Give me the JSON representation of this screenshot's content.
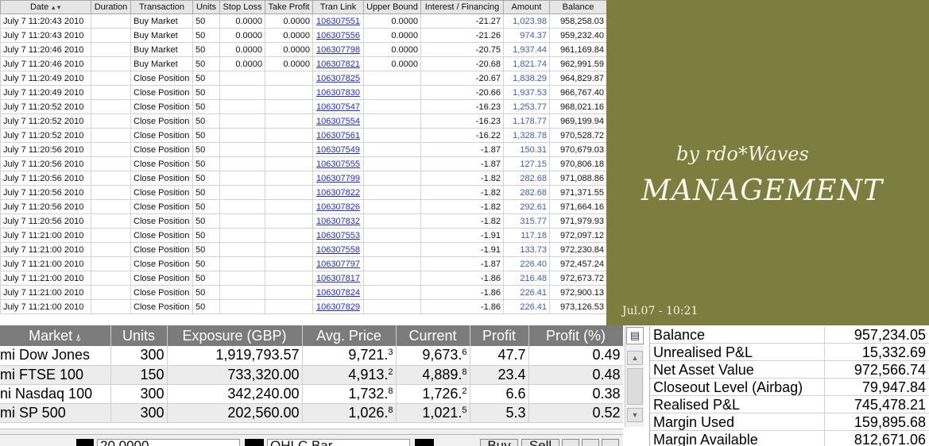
{
  "trades": {
    "columns": [
      "Date",
      "Duration",
      "Transaction",
      "Units",
      "Stop Loss",
      "Take Profit",
      "Tran Link",
      "Upper Bound",
      "Interest / Financing",
      "Amount",
      "Balance"
    ],
    "rows": [
      {
        "date": "July 7 11:20:43 2010",
        "duration": "",
        "transaction": "Buy Market",
        "units": "50",
        "stop_loss": "0.0000",
        "take_profit": "0.0000",
        "tran_link": "106307551",
        "upper_bound": "0.0000",
        "interest": "-21.27",
        "amount": "1,023.98",
        "balance": "958,258.03"
      },
      {
        "date": "July 7 11:20:43 2010",
        "duration": "",
        "transaction": "Buy Market",
        "units": "50",
        "stop_loss": "0.0000",
        "take_profit": "0.0000",
        "tran_link": "106307556",
        "upper_bound": "0.0000",
        "interest": "-21.26",
        "amount": "974.37",
        "balance": "959,232.40"
      },
      {
        "date": "July 7 11:20:46 2010",
        "duration": "",
        "transaction": "Buy Market",
        "units": "50",
        "stop_loss": "0.0000",
        "take_profit": "0.0000",
        "tran_link": "106307798",
        "upper_bound": "0.0000",
        "interest": "-20.75",
        "amount": "1,937.44",
        "balance": "961,169.84"
      },
      {
        "date": "July 7 11:20:46 2010",
        "duration": "",
        "transaction": "Buy Market",
        "units": "50",
        "stop_loss": "0.0000",
        "take_profit": "0.0000",
        "tran_link": "106307821",
        "upper_bound": "0.0000",
        "interest": "-20.68",
        "amount": "1,821.74",
        "balance": "962,991.59"
      },
      {
        "date": "July 7 11:20:49 2010",
        "duration": "",
        "transaction": "Close Position",
        "units": "50",
        "stop_loss": "",
        "take_profit": "",
        "tran_link": "106307825",
        "upper_bound": "",
        "interest": "-20.67",
        "amount": "1,838.29",
        "balance": "964,829.87"
      },
      {
        "date": "July 7 11:20:49 2010",
        "duration": "",
        "transaction": "Close Position",
        "units": "50",
        "stop_loss": "",
        "take_profit": "",
        "tran_link": "106307830",
        "upper_bound": "",
        "interest": "-20.66",
        "amount": "1,937.53",
        "balance": "966,767.40"
      },
      {
        "date": "July 7 11:20:52 2010",
        "duration": "",
        "transaction": "Close Position",
        "units": "50",
        "stop_loss": "",
        "take_profit": "",
        "tran_link": "106307547",
        "upper_bound": "",
        "interest": "-16.23",
        "amount": "1,253.77",
        "balance": "968,021.16"
      },
      {
        "date": "July 7 11:20:52 2010",
        "duration": "",
        "transaction": "Close Position",
        "units": "50",
        "stop_loss": "",
        "take_profit": "",
        "tran_link": "106307554",
        "upper_bound": "",
        "interest": "-16.23",
        "amount": "1,178.77",
        "balance": "969,199.94"
      },
      {
        "date": "July 7 11:20:52 2010",
        "duration": "",
        "transaction": "Close Position",
        "units": "50",
        "stop_loss": "",
        "take_profit": "",
        "tran_link": "106307561",
        "upper_bound": "",
        "interest": "-16.22",
        "amount": "1,328.78",
        "balance": "970,528.72"
      },
      {
        "date": "July 7 11:20:56 2010",
        "duration": "",
        "transaction": "Close Position",
        "units": "50",
        "stop_loss": "",
        "take_profit": "",
        "tran_link": "106307549",
        "upper_bound": "",
        "interest": "-1.87",
        "amount": "150.31",
        "balance": "970,679.03"
      },
      {
        "date": "July 7 11:20:56 2010",
        "duration": "",
        "transaction": "Close Position",
        "units": "50",
        "stop_loss": "",
        "take_profit": "",
        "tran_link": "106307555",
        "upper_bound": "",
        "interest": "-1.87",
        "amount": "127.15",
        "balance": "970,806.18"
      },
      {
        "date": "July 7 11:20:56 2010",
        "duration": "",
        "transaction": "Close Position",
        "units": "50",
        "stop_loss": "",
        "take_profit": "",
        "tran_link": "106307799",
        "upper_bound": "",
        "interest": "-1.82",
        "amount": "282.68",
        "balance": "971,088.86"
      },
      {
        "date": "July 7 11:20:56 2010",
        "duration": "",
        "transaction": "Close Position",
        "units": "50",
        "stop_loss": "",
        "take_profit": "",
        "tran_link": "106307822",
        "upper_bound": "",
        "interest": "-1.82",
        "amount": "282.68",
        "balance": "971,371.55"
      },
      {
        "date": "July 7 11:20:56 2010",
        "duration": "",
        "transaction": "Close Position",
        "units": "50",
        "stop_loss": "",
        "take_profit": "",
        "tran_link": "106307826",
        "upper_bound": "",
        "interest": "-1.82",
        "amount": "292.61",
        "balance": "971,664.16"
      },
      {
        "date": "July 7 11:20:56 2010",
        "duration": "",
        "transaction": "Close Position",
        "units": "50",
        "stop_loss": "",
        "take_profit": "",
        "tran_link": "106307832",
        "upper_bound": "",
        "interest": "-1.82",
        "amount": "315.77",
        "balance": "971,979.93"
      },
      {
        "date": "July 7 11:21:00 2010",
        "duration": "",
        "transaction": "Close Position",
        "units": "50",
        "stop_loss": "",
        "take_profit": "",
        "tran_link": "106307553",
        "upper_bound": "",
        "interest": "-1.91",
        "amount": "117.18",
        "balance": "972,097.12"
      },
      {
        "date": "July 7 11:21:00 2010",
        "duration": "",
        "transaction": "Close Position",
        "units": "50",
        "stop_loss": "",
        "take_profit": "",
        "tran_link": "106307558",
        "upper_bound": "",
        "interest": "-1.91",
        "amount": "133.73",
        "balance": "972,230.84"
      },
      {
        "date": "July 7 11:21:00 2010",
        "duration": "",
        "transaction": "Close Position",
        "units": "50",
        "stop_loss": "",
        "take_profit": "",
        "tran_link": "106307797",
        "upper_bound": "",
        "interest": "-1.87",
        "amount": "226.40",
        "balance": "972,457.24"
      },
      {
        "date": "July 7 11:21:00 2010",
        "duration": "",
        "transaction": "Close Position",
        "units": "50",
        "stop_loss": "",
        "take_profit": "",
        "tran_link": "106307817",
        "upper_bound": "",
        "interest": "-1.86",
        "amount": "216.48",
        "balance": "972,673.72"
      },
      {
        "date": "July 7 11:21:00 2010",
        "duration": "",
        "transaction": "Close Position",
        "units": "50",
        "stop_loss": "",
        "take_profit": "",
        "tran_link": "106307824",
        "upper_bound": "",
        "interest": "-1.86",
        "amount": "226.41",
        "balance": "972,900.13"
      },
      {
        "date": "July 7 11:21:00 2010",
        "duration": "",
        "transaction": "Close Position",
        "units": "50",
        "stop_loss": "",
        "take_profit": "",
        "tran_link": "106307829",
        "upper_bound": "",
        "interest": "-1.86",
        "amount": "226.41",
        "balance": "973,126.53"
      }
    ],
    "sort_icon": "sort-arrows-icon"
  },
  "brand": {
    "byline": "by rdo*Waves",
    "title": "MANAGEMENT",
    "date_time": "Jul.07 - 10:21",
    "background_color": "#7d7d3f"
  },
  "positions": {
    "columns": [
      "Market",
      "Units",
      "Exposure (GBP)",
      "Avg. Price",
      "Current",
      "Profit",
      "Profit (%)"
    ],
    "rows": [
      {
        "market": "mi Dow Jones",
        "units": "300",
        "exposure": "1,919,793.57",
        "avg_main": "9,721.",
        "avg_sup": "3",
        "cur_main": "9,673.",
        "cur_sup": "6",
        "profit": "47.7",
        "profit_pct": "0.49"
      },
      {
        "market": "mi FTSE 100",
        "units": "150",
        "exposure": "733,320.00",
        "avg_main": "4,913.",
        "avg_sup": "2",
        "cur_main": "4,889.",
        "cur_sup": "8",
        "profit": "23.4",
        "profit_pct": "0.48"
      },
      {
        "market": "ni Nasdaq 100",
        "units": "300",
        "exposure": "342,240.00",
        "avg_main": "1,732.",
        "avg_sup": "8",
        "cur_main": "1,726.",
        "cur_sup": "2",
        "profit": "6.6",
        "profit_pct": "0.38"
      },
      {
        "market": "mi SP 500",
        "units": "300",
        "exposure": "202,560.00",
        "avg_main": "1,026.",
        "avg_sup": "8",
        "cur_main": "1,021.",
        "cur_sup": "5",
        "profit": "5.3",
        "profit_pct": "0.52"
      }
    ],
    "header_color": "#7b7b7b",
    "options_icon": "options-menu-icon"
  },
  "account": {
    "rows": [
      {
        "label": "Balance",
        "value": "957,234.05"
      },
      {
        "label": "Unrealised P&L",
        "value": "15,332.69"
      },
      {
        "label": "Net Asset Value",
        "value": "972,566.74"
      },
      {
        "label": "Closeout Level (Airbag)",
        "value": "79,947.84"
      },
      {
        "label": "Realised P&L",
        "value": "745,478.21"
      },
      {
        "label": "Margin Used",
        "value": "159,895.68"
      },
      {
        "label": "Margin Available",
        "value": "812,671.06"
      }
    ]
  },
  "order_bar": {
    "amount_value": "20.0000",
    "chart_type": "OHLC Bar",
    "buy_label": "Buy",
    "sell_label": "Sell"
  }
}
